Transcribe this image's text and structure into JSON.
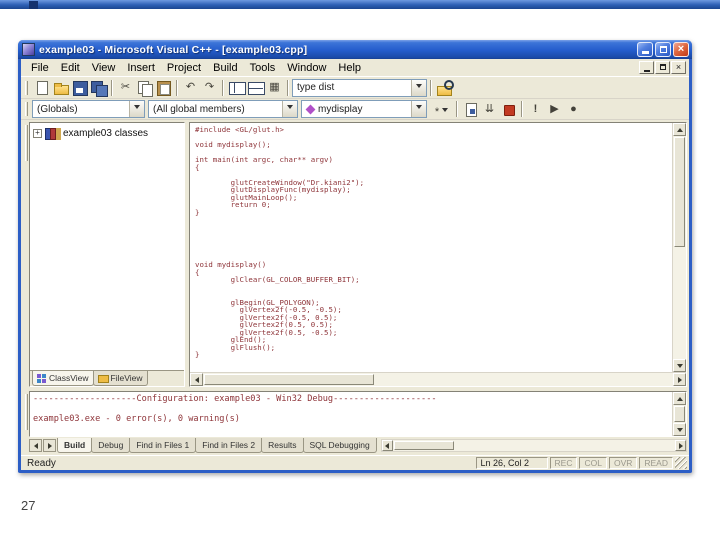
{
  "slide": {
    "page_number": "27"
  },
  "window": {
    "title": "example03 - Microsoft Visual C++ - [example03.cpp]"
  },
  "menu": {
    "items": [
      "File",
      "Edit",
      "View",
      "Insert",
      "Project",
      "Build",
      "Tools",
      "Window",
      "Help"
    ]
  },
  "toolbar_standard": {
    "icons": [
      "new-file",
      "open-folder",
      "save",
      "save-all",
      "cut",
      "copy",
      "paste",
      "undo",
      "redo",
      "workspace-pane",
      "output-pane",
      "window-list",
      "find-in-files"
    ],
    "find_combo_value": "type dist"
  },
  "wizard_bar": {
    "class_combo_value": "(Globals)",
    "members_combo_value": "(All global members)",
    "function_combo_value": "mydisplay",
    "icons": [
      "wizard-actions",
      "compile",
      "build",
      "stop-build",
      "execute-program",
      "go",
      "insert-breakpoint"
    ]
  },
  "workspace": {
    "tree_root_label": "example03 classes",
    "tabs": [
      "ClassView",
      "FileView"
    ],
    "active_tab": "ClassView"
  },
  "editor": {
    "file": "example03.cpp",
    "code_lines": [
      "#include <GL/glut.h>",
      "",
      "void mydisplay();",
      "",
      "int main(int argc, char** argv)",
      "{",
      "",
      "        glutCreateWindow(\"Dr.kiani2\");",
      "        glutDisplayFunc(mydisplay);",
      "        glutMainLoop();",
      "        return 0;",
      "}",
      "",
      "",
      "",
      "",
      "",
      "",
      "void mydisplay()",
      "{",
      "        glClear(GL_COLOR_BUFFER_BIT);",
      "",
      "",
      "        glBegin(GL_POLYGON);",
      "          glVertex2f(-0.5, -0.5);",
      "          glVertex2f(-0.5, 0.5);",
      "          glVertex2f(0.5, 0.5);",
      "          glVertex2f(0.5, -0.5);",
      "        glEnd();",
      "        glFlush();",
      "}"
    ]
  },
  "output": {
    "lines": [
      "--------------------Configuration: example03 - Win32 Debug--------------------",
      "",
      "example03.exe - 0 error(s), 0 warning(s)"
    ],
    "tabs": [
      "Build",
      "Debug",
      "Find in Files 1",
      "Find in Files 2",
      "Results",
      "SQL Debugging"
    ],
    "active_tab": "Build"
  },
  "status_bar": {
    "message": "Ready",
    "position": "Ln 26, Col 2",
    "indicators": [
      "REC",
      "COL",
      "OVR",
      "READ"
    ]
  },
  "colors": {
    "titlebar_blue": "#245ccc",
    "close_button_red": "#d9512c",
    "toolbar_face": "#ece9d8",
    "code_text": "#8e3439",
    "slide_bar_blue": "#2d5fb4"
  }
}
